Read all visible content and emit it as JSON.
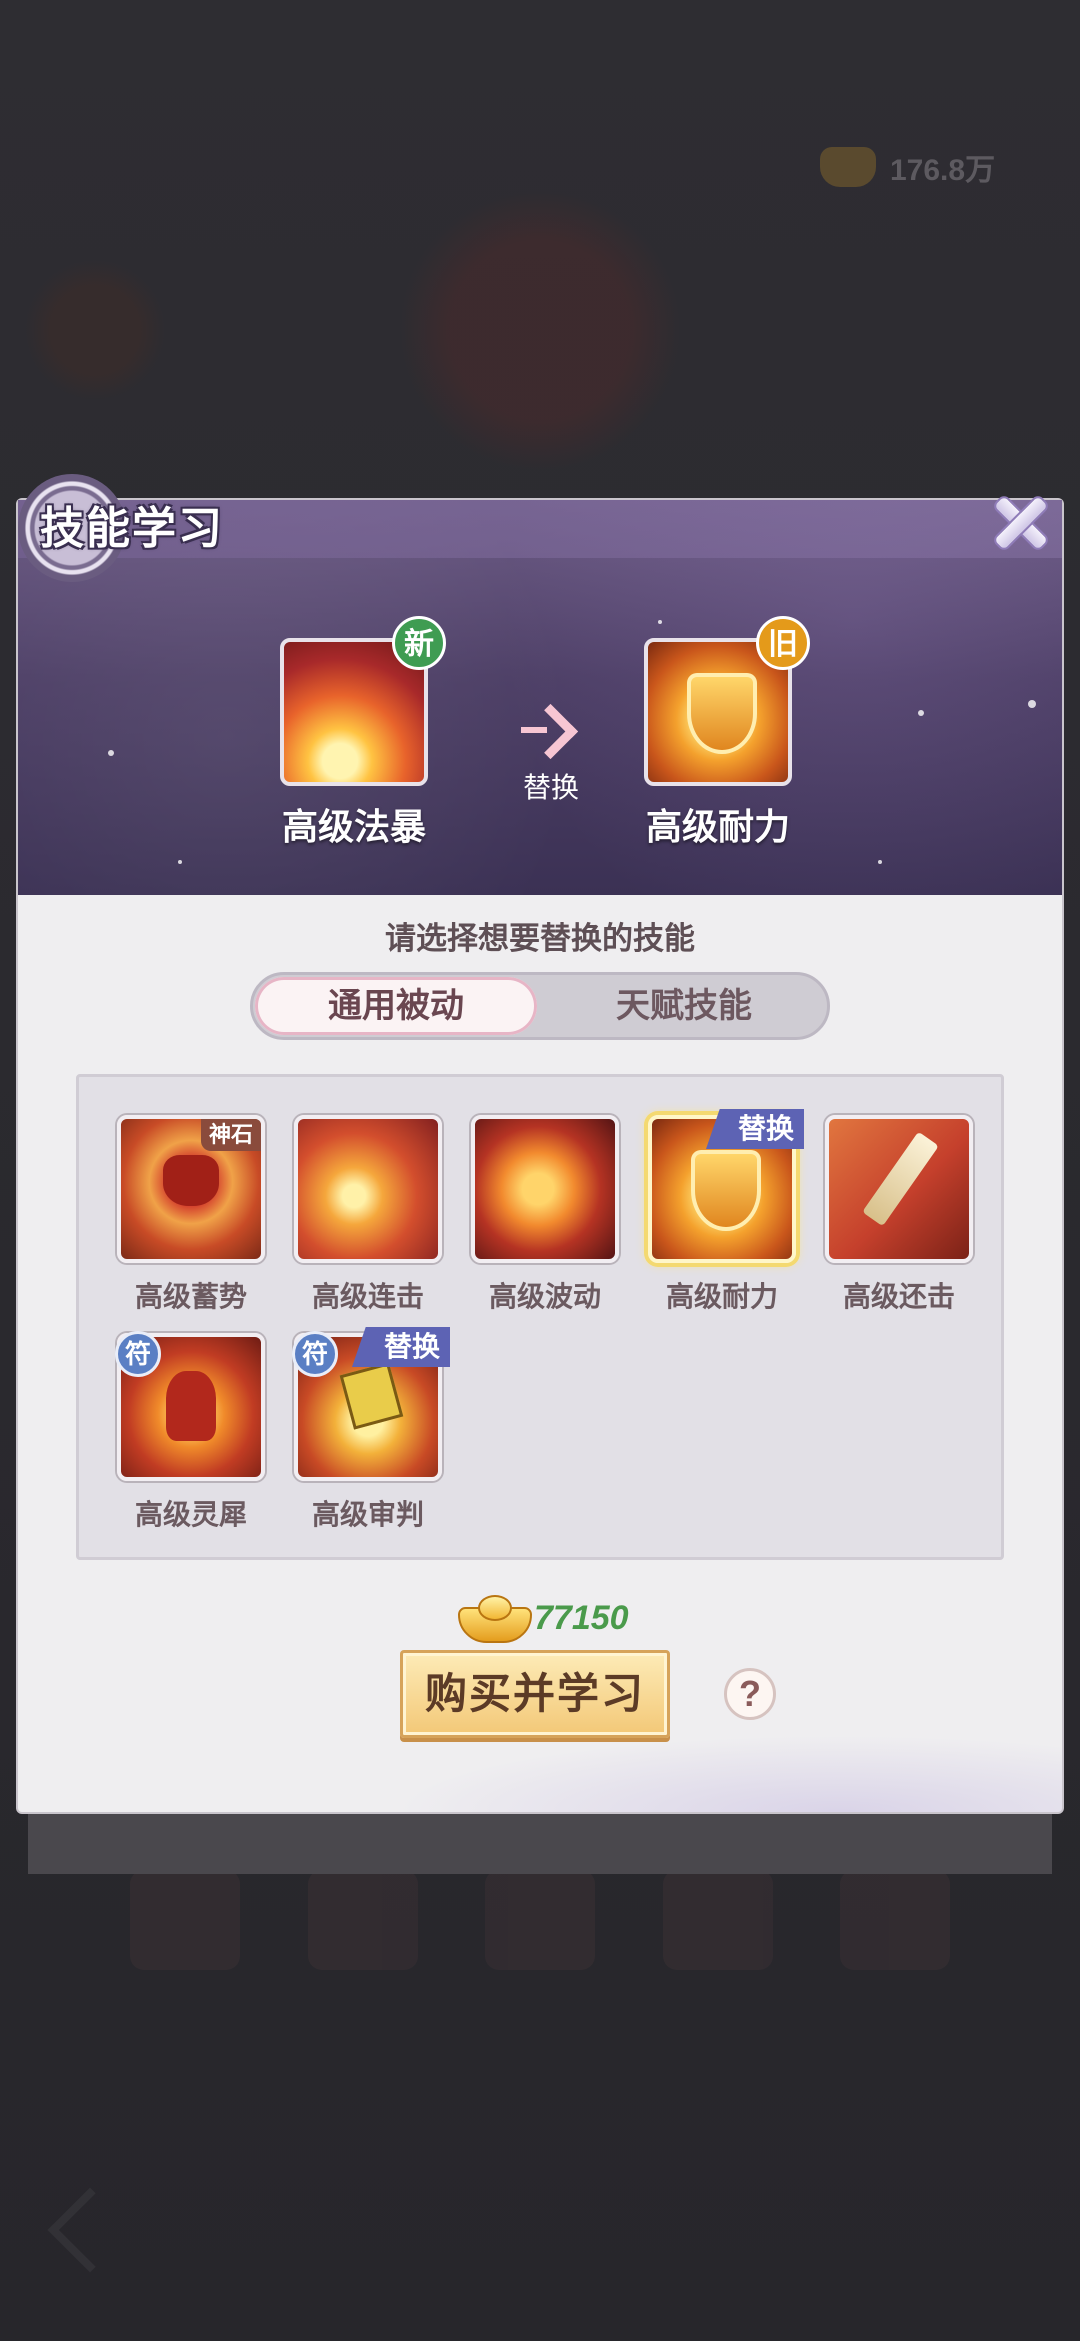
{
  "background": {
    "currency_amount": "176.8万"
  },
  "dialog": {
    "title": "技能学习",
    "new_skill": {
      "name": "高级法暴",
      "tag": "新"
    },
    "old_skill": {
      "name": "高级耐力",
      "tag": "旧"
    },
    "swap_label": "替换",
    "prompt": "请选择想要替换的技能",
    "tabs": [
      {
        "label": "通用被动",
        "active": true
      },
      {
        "label": "天赋技能",
        "active": false
      }
    ],
    "skills": [
      {
        "name": "高级蓄势",
        "badge": "神石",
        "icon": "cat-icon"
      },
      {
        "name": "高级连击",
        "badge": "",
        "icon": "combo-icon"
      },
      {
        "name": "高级波动",
        "badge": "",
        "icon": "wave-icon"
      },
      {
        "name": "高级耐力",
        "badge": "替换",
        "icon": "shield-icon",
        "selected": true
      },
      {
        "name": "高级还击",
        "badge": "",
        "icon": "sword-icon"
      },
      {
        "name": "高级灵犀",
        "badge": "符",
        "icon": "spirit-cat-icon"
      },
      {
        "name": "高级审判",
        "badge": "符",
        "badge2": "替换",
        "icon": "judgement-book-icon"
      }
    ],
    "price": "77150",
    "buy_button": "购买并学习",
    "help_button": "?"
  },
  "colors": {
    "header_purple": "#4d3f66",
    "price_green": "#4a9a4b",
    "swap_badge_blue": "#5d63b4",
    "button_gold": "#f3c877"
  }
}
